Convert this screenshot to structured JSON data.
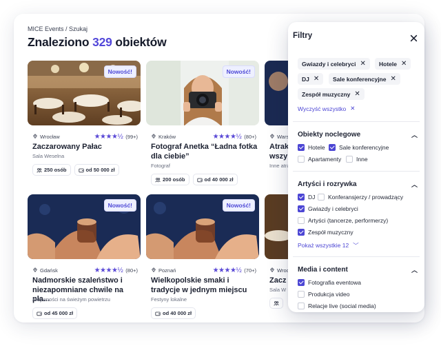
{
  "breadcrumb": "MICE Events / Szukaj",
  "title": {
    "prefix": "Znaleziono",
    "count": "329",
    "suffix": "obiektów"
  },
  "badge_new": "Nowość!",
  "cards": [
    {
      "city": "Wrocław",
      "reviews": "(99+)",
      "title": "Zaczarowany Pałac",
      "subtitle": "Sala Weselna",
      "chip1": "250 osób",
      "chip2": "od 50 000 zł"
    },
    {
      "city": "Kraków",
      "reviews": "(80+)",
      "title": "Fotograf Anetka “Ładna fotka dla ciebie”",
      "subtitle": "Fotograf",
      "chip1": "200 osób",
      "chip2": "od 40 000 zł"
    },
    {
      "city": "Wars",
      "title": "Atrak wszy",
      "subtitle": "Inne atra"
    },
    {
      "city": "Gdańsk",
      "reviews": "(80+)",
      "title": "Nadmorskie szaleństwo i niezapomniane chwile na pla...",
      "subtitle": "Aktywności na świeżym powietrzu",
      "chip1": "od 45 000 zł"
    },
    {
      "city": "Poznań",
      "reviews": "(70+)",
      "title": "Wielkopolskie smaki i tradycje w jednym miejscu",
      "subtitle": "Festyny lokalne",
      "chip1": "od 40 000 zł"
    },
    {
      "city": "Wroc",
      "title": "Zacz",
      "subtitle": "Sala W"
    }
  ],
  "filters": {
    "title": "Filtry",
    "active_tags": [
      "Gwiazdy i celebryci",
      "Hotele",
      "DJ",
      "Sale konferencyjne",
      "Zespół muzyczny"
    ],
    "clear_all": "Wyczyść wszystko",
    "sections": [
      {
        "title": "Obiekty noclegowe",
        "options": [
          {
            "label": "Hotele",
            "checked": true
          },
          {
            "label": "Sale konferencyjne",
            "checked": true
          },
          {
            "label": "Apartamenty",
            "checked": false
          },
          {
            "label": "Inne",
            "checked": false
          }
        ]
      },
      {
        "title": "Artyści i rozrywka",
        "options": [
          {
            "label": "DJ",
            "checked": true
          },
          {
            "label": "Konferansjerzy / prowadzący",
            "checked": false
          },
          {
            "label": "Gwiazdy i celebryci",
            "checked": true
          },
          {
            "label": "Artyści (tancerze, performerzy)",
            "checked": false
          },
          {
            "label": "Zespół muzyczny",
            "checked": true
          }
        ],
        "show_more": "Pokaż wszystkie 12"
      },
      {
        "title": "Media i content",
        "options": [
          {
            "label": "Fotografia eventowa",
            "checked": true
          },
          {
            "label": "Produkcja video",
            "checked": false
          },
          {
            "label": "Relacje live (social media)",
            "checked": false
          }
        ]
      }
    ]
  },
  "colors": {
    "accent": "#4c46d4",
    "star": "#5a49d6"
  },
  "rating_stars": "★★★★½"
}
